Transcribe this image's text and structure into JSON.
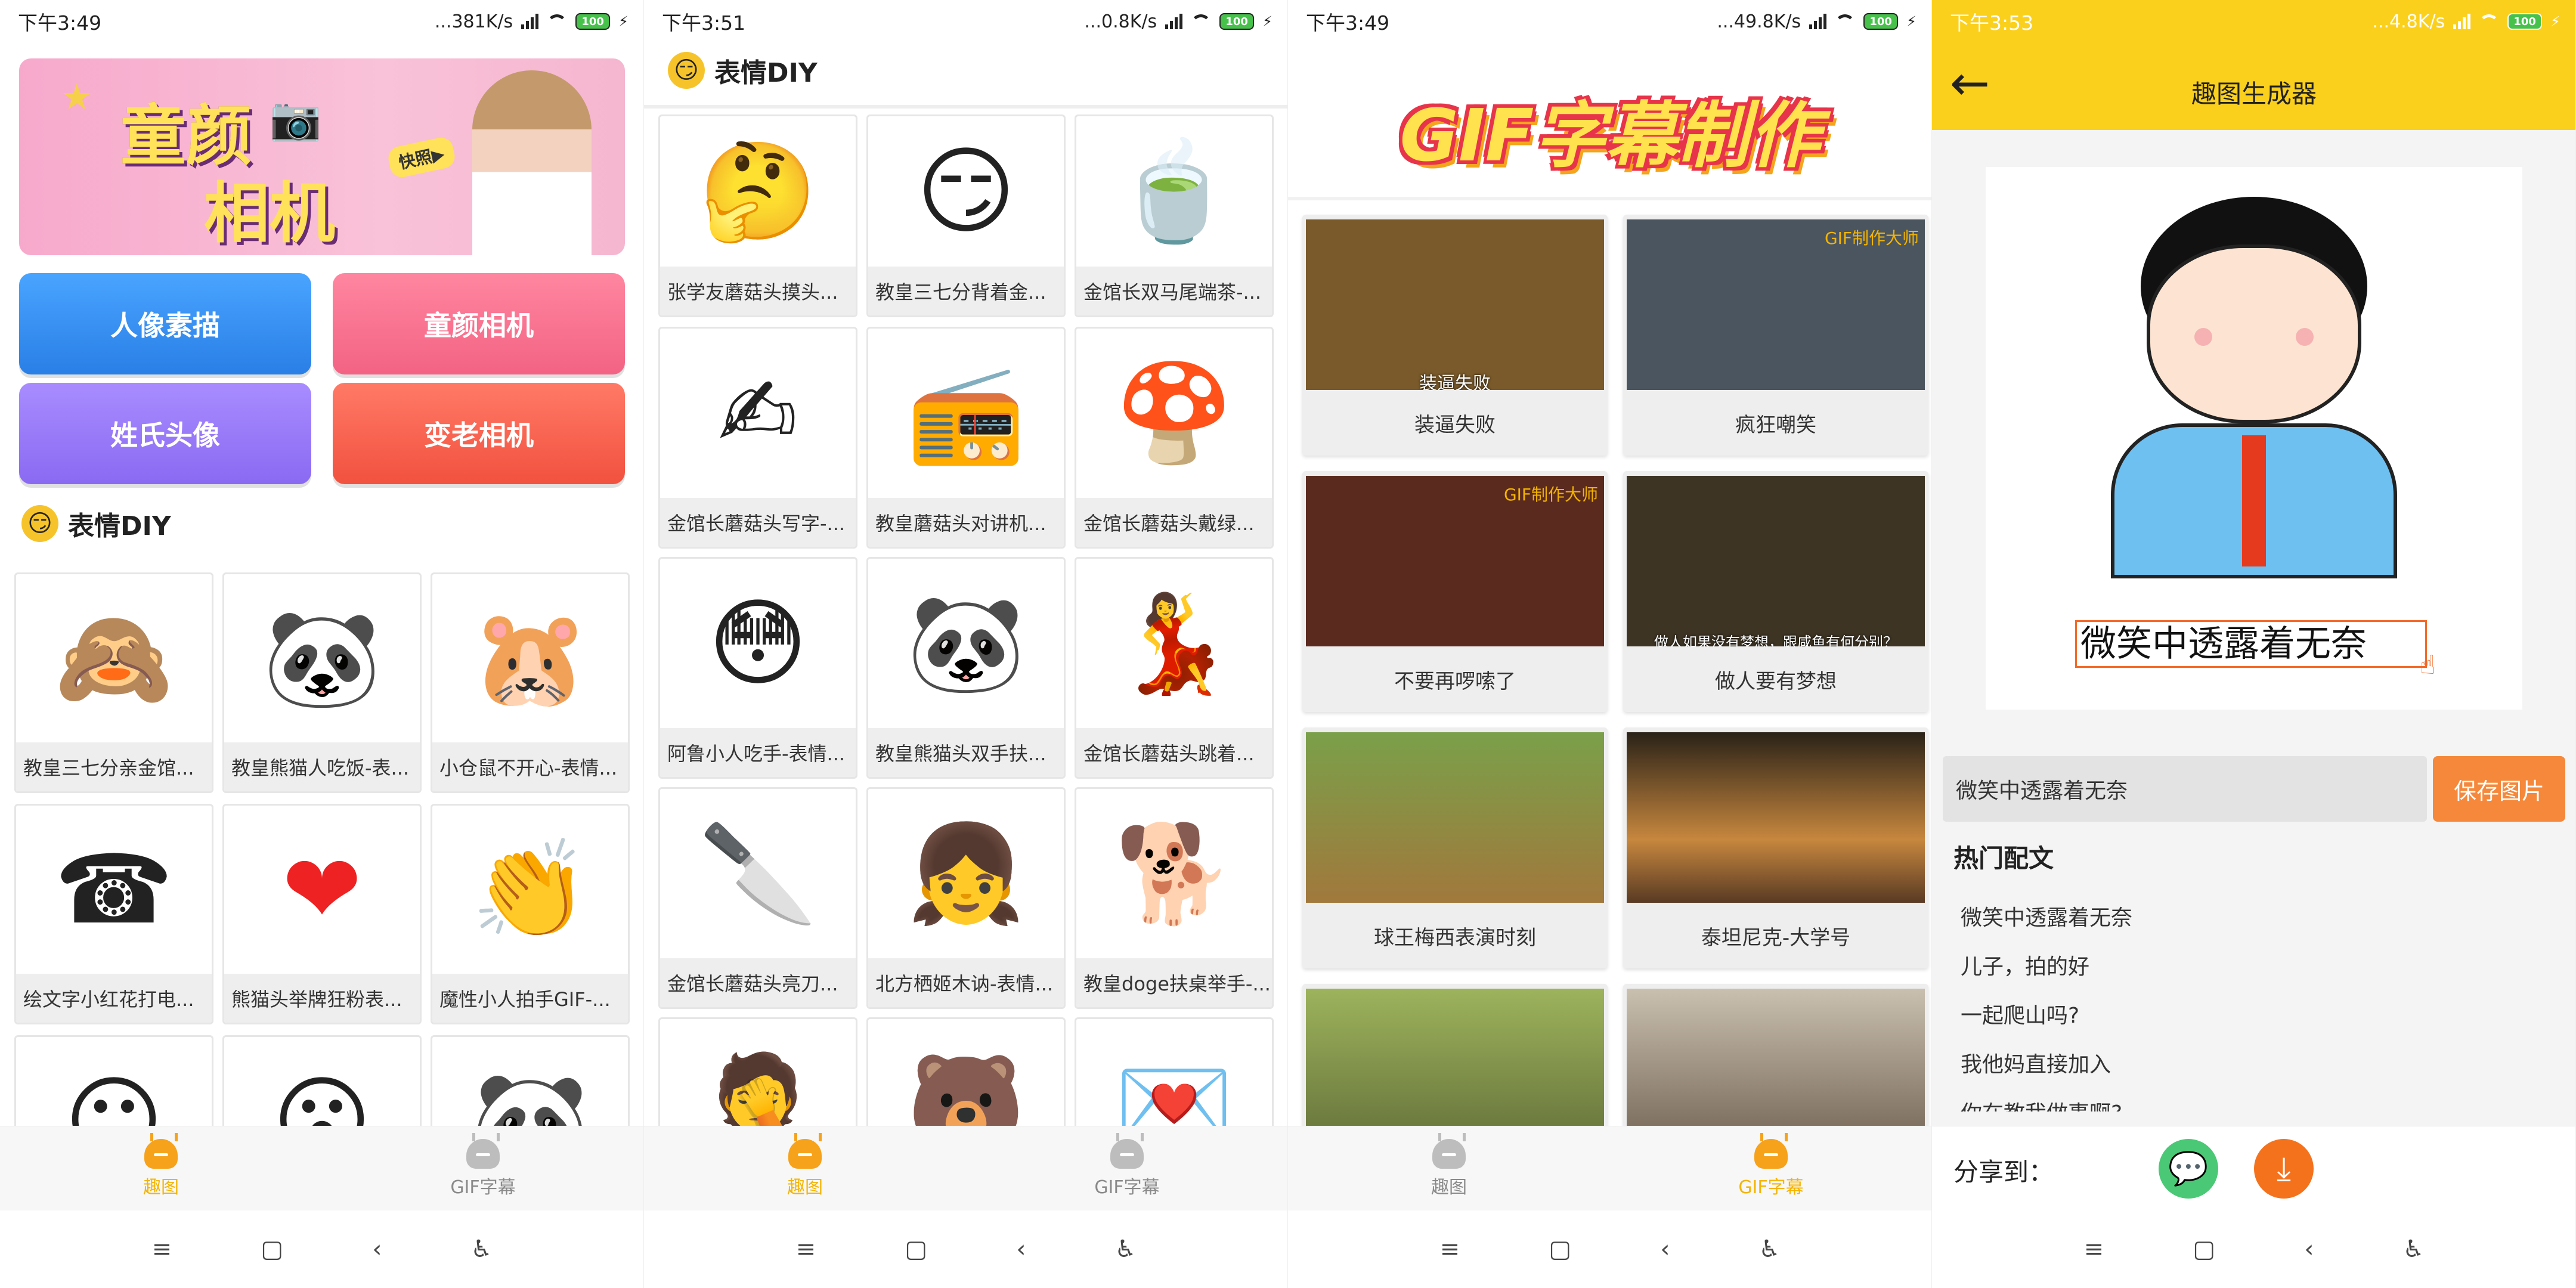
{
  "screens": [
    {
      "status": {
        "time": "下午3:49",
        "speed": "...381K/s",
        "battery": "100"
      },
      "banner": {
        "title1": "童颜",
        "title2": "相机",
        "tag": "快照▶"
      },
      "buttons": [
        {
          "label": "人像素描",
          "color": "#2f8df6"
        },
        {
          "label": "童颜相机",
          "color": "#f86f88"
        },
        {
          "label": "姓氏头像",
          "color": "#8d6ef8"
        },
        {
          "label": "变老相机",
          "color": "#f75a4a"
        }
      ],
      "section_title": "表情DIY",
      "tiles": [
        {
          "caption": "教皇三七分亲金馆...",
          "icon": "🙈"
        },
        {
          "caption": "教皇熊猫人吃饭-表...",
          "icon": "🐼"
        },
        {
          "caption": "小仓鼠不开心-表情...",
          "icon": "🐹"
        },
        {
          "caption": "绘文字小红花打电...",
          "icon": "☎"
        },
        {
          "caption": "熊猫头举牌狂粉表...",
          "icon": "❤"
        },
        {
          "caption": "魔性小人拍手GIF-...",
          "icon": "👏"
        },
        {
          "caption": "",
          "icon": "😶"
        },
        {
          "caption": "",
          "icon": "😮"
        },
        {
          "caption": "",
          "icon": "🐼"
        }
      ],
      "nav": {
        "tab1": "趣图",
        "tab2": "GIF字幕",
        "active": 1
      }
    },
    {
      "status": {
        "time": "下午3:51",
        "speed": "...0.8K/s",
        "battery": "100"
      },
      "header_title": "表情DIY",
      "tiles": [
        {
          "caption": "张学友蘑菇头摸头...",
          "icon": "🤔"
        },
        {
          "caption": "教皇三七分背着金...",
          "icon": "😏"
        },
        {
          "caption": "金馆长双马尾端茶-...",
          "icon": "🍵"
        },
        {
          "caption": "金馆长蘑菇头写字-...",
          "icon": "✍"
        },
        {
          "caption": "教皇蘑菇头对讲机...",
          "icon": "📻"
        },
        {
          "caption": "金馆长蘑菇头戴绿...",
          "icon": "🍄"
        },
        {
          "caption": "阿鲁小人吃手-表情...",
          "icon": "😳"
        },
        {
          "caption": "教皇熊猫头双手扶...",
          "icon": "🐼"
        },
        {
          "caption": "金馆长蘑菇头跳着...",
          "icon": "💃"
        },
        {
          "caption": "金馆长蘑菇头亮刀...",
          "icon": "🔪"
        },
        {
          "caption": "北方栖姬木讷-表情...",
          "icon": "👧"
        },
        {
          "caption": "教皇doge扶桌举手-...",
          "icon": "🐕"
        },
        {
          "caption": "",
          "icon": "🤦"
        },
        {
          "caption": "",
          "icon": "🐻"
        },
        {
          "caption": "",
          "icon": "💌"
        }
      ],
      "nav": {
        "tab1": "趣图",
        "tab2": "GIF字幕",
        "active": 1
      }
    },
    {
      "status": {
        "time": "下午3:49",
        "speed": "...49.8K/s",
        "battery": "100"
      },
      "title_banner": "GIF字幕制作",
      "gifs": [
        {
          "caption": "装逼失败",
          "subtitle": "装逼失败",
          "watermark": "",
          "color": "#7a5a2a"
        },
        {
          "caption": "疯狂嘲笑",
          "subtitle": "",
          "watermark": "GIF制作大师",
          "color": "#4a5560"
        },
        {
          "caption": "不要再啰嗦了",
          "subtitle": "",
          "watermark": "GIF制作大师",
          "color": "#5b2a1f"
        },
        {
          "caption": "做人要有梦想",
          "subtitle": "做人如果没有梦想，跟咸鱼有何分别？",
          "watermark": "",
          "color": "#3d3424"
        },
        {
          "caption": "球王梅西表演时刻",
          "subtitle": "",
          "watermark": "",
          "color": "#5c7f3a"
        },
        {
          "caption": "泰坦尼克-大学号",
          "subtitle": "",
          "watermark": "",
          "color": "#8a5a2a"
        },
        {
          "caption": "",
          "subtitle": "",
          "watermark": "",
          "color": "#6b7a3a"
        },
        {
          "caption": "",
          "subtitle": "",
          "watermark": "",
          "color": "#8a7a6a"
        }
      ],
      "nav": {
        "tab1": "趣图",
        "tab2": "GIF字幕",
        "active": 2
      }
    },
    {
      "status": {
        "time": "下午3:53",
        "speed": "...4.8K/s",
        "battery": "100"
      },
      "header_title": "趣图生成器",
      "caption_overlay": "微笑中透露着无奈",
      "input_value": "微笑中透露着无奈",
      "save_button": "保存图片",
      "hot_title": "热门配文",
      "hot_items": [
        "微笑中透露着无奈",
        "儿子，拍的好",
        "一起爬山吗?",
        "我他妈直接加入",
        "你在教我做事啊?"
      ],
      "share_label": "分享到："
    }
  ]
}
